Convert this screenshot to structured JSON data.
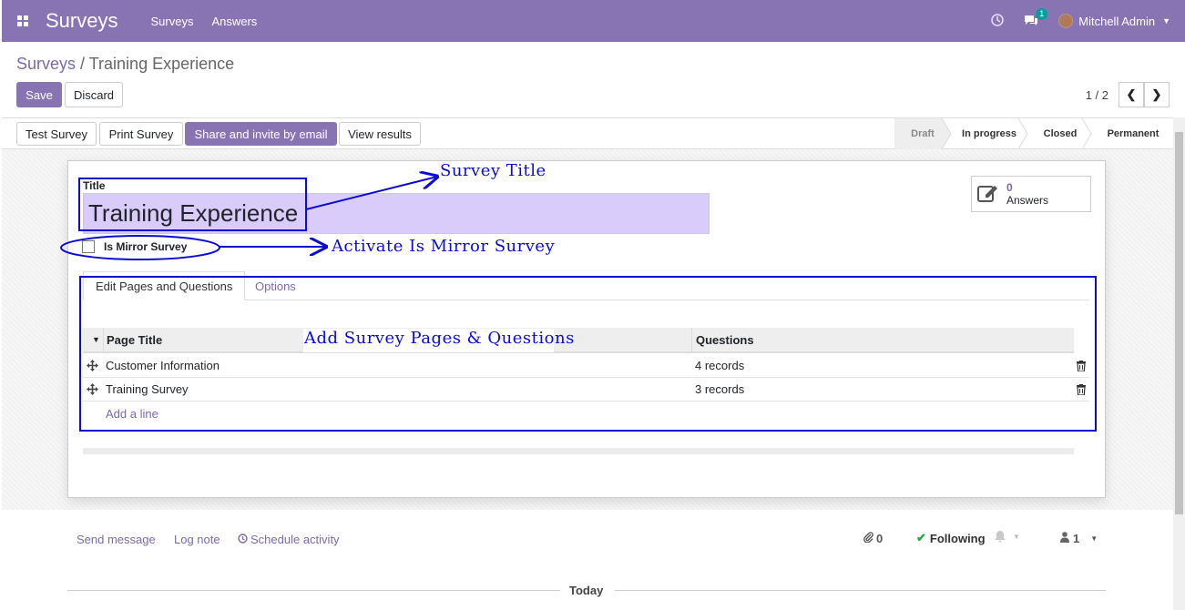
{
  "navbar": {
    "brand": "Surveys",
    "menu": [
      "Surveys",
      "Answers"
    ],
    "message_count": "1",
    "user": "Mitchell Admin"
  },
  "breadcrumb": {
    "parent": "Surveys",
    "separator": " / ",
    "current": "Training Experience"
  },
  "actions": {
    "save": "Save",
    "discard": "Discard"
  },
  "pager": {
    "text": "1 / 2"
  },
  "header_buttons": [
    "Test Survey",
    "Print Survey",
    "Share and invite by email",
    "View results"
  ],
  "stages": [
    "Draft",
    "In progress",
    "Closed",
    "Permanent"
  ],
  "form": {
    "title_label": "Title",
    "title_value": "Training Experience",
    "mirror_label": "Is Mirror Survey",
    "answers_count": "0",
    "answers_label": "Answers"
  },
  "tabs": [
    "Edit Pages and Questions",
    "Options"
  ],
  "table": {
    "headers": [
      "Page Title",
      "Questions"
    ],
    "rows": [
      {
        "title": "Customer Information",
        "questions": "4 records"
      },
      {
        "title": "Training Survey",
        "questions": "3 records"
      }
    ],
    "add_line": "Add a line"
  },
  "chatter": {
    "send_message": "Send message",
    "log_note": "Log note",
    "schedule": "Schedule activity",
    "attachments": "0",
    "following": "Following",
    "followers": "1",
    "today": "Today"
  },
  "annotations": {
    "survey_title": "Survey Title",
    "mirror": "Activate Is Mirror Survey",
    "pages": "Add Survey Pages & Questions"
  },
  "colors": {
    "brand": "#8874b3",
    "annotation": "#0b0bd4"
  }
}
